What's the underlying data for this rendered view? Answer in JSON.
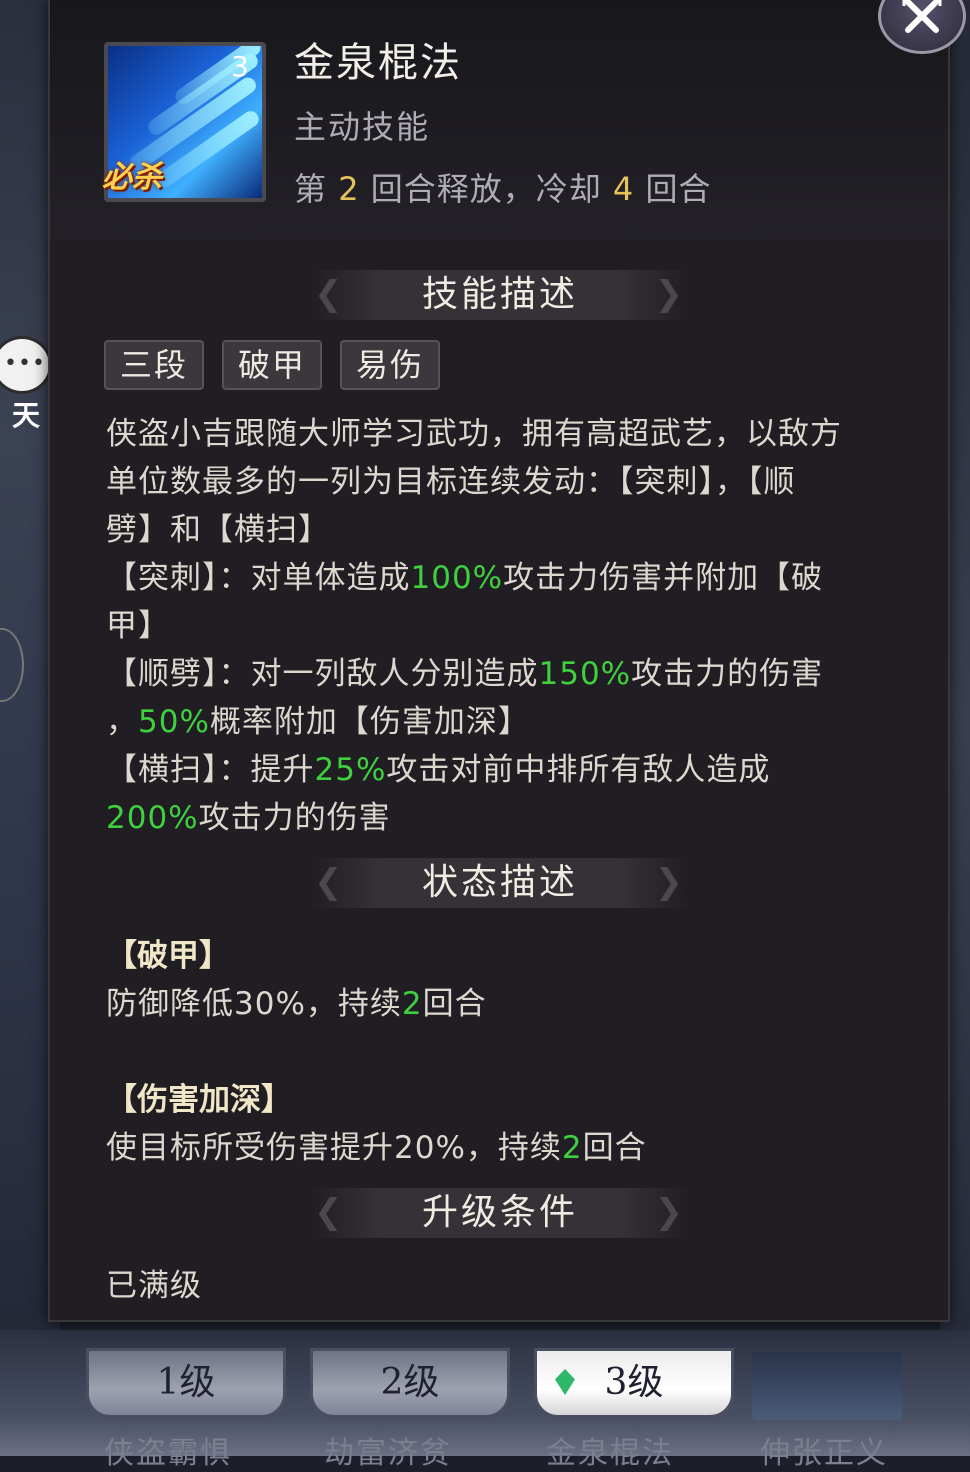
{
  "side": {
    "label": "天"
  },
  "skill": {
    "level": "3",
    "badge": "必杀",
    "name": "金泉棍法",
    "type": "主动技能",
    "cast_prefix": "第",
    "cast_round": "2",
    "cast_mid": "回合释放，冷却",
    "cooldown": "4",
    "cast_suffix": "回合"
  },
  "sections": {
    "description": "技能描述",
    "status": "状态描述",
    "upgrade": "升级条件"
  },
  "tags": [
    "三段",
    "破甲",
    "易伤"
  ],
  "description": {
    "line1": "侠盗小吉跟随大师学习武功，拥有高超武艺，以敌方",
    "line2": "单位数最多的一列为目标连续发动：【突刺】，【顺",
    "line3": "劈】和【横扫】",
    "l4a": "【突刺】：对单体造成",
    "l4g": "100%",
    "l4b": "攻击力伤害并附加【破",
    "line5": "甲】",
    "l6a": "【顺劈】：对一列敌人分别造成",
    "l6g": "150%",
    "l6b": "攻击力的伤害",
    "l7a": "，",
    "l7g": "50%",
    "l7b": "概率附加【伤害加深】",
    "l8a": "【横扫】：提升",
    "l8g": "25%",
    "l8b": "攻击对前中排所有敌人造成",
    "l9g": "200%",
    "l9b": "攻击力的伤害"
  },
  "status": [
    {
      "name": "【破甲】",
      "text_a": "防御降低30%，持续",
      "value": "2",
      "text_b": "回合"
    },
    {
      "name": "【伤害加深】",
      "text_a": "使目标所受伤害提升20%，持续",
      "value": "2",
      "text_b": "回合"
    }
  ],
  "upgrade_text": "已满级",
  "tabs": [
    {
      "label": "1级",
      "sub": "侠盗霸惧"
    },
    {
      "label": "2级",
      "sub": "劫富济贫"
    },
    {
      "label": "3级",
      "sub": "金泉棍法"
    },
    {
      "label": "",
      "sub": "伸张正义"
    }
  ],
  "colors": {
    "highlight": "#3fd03f",
    "number": "#e3c35a",
    "panel": "#201e22"
  }
}
